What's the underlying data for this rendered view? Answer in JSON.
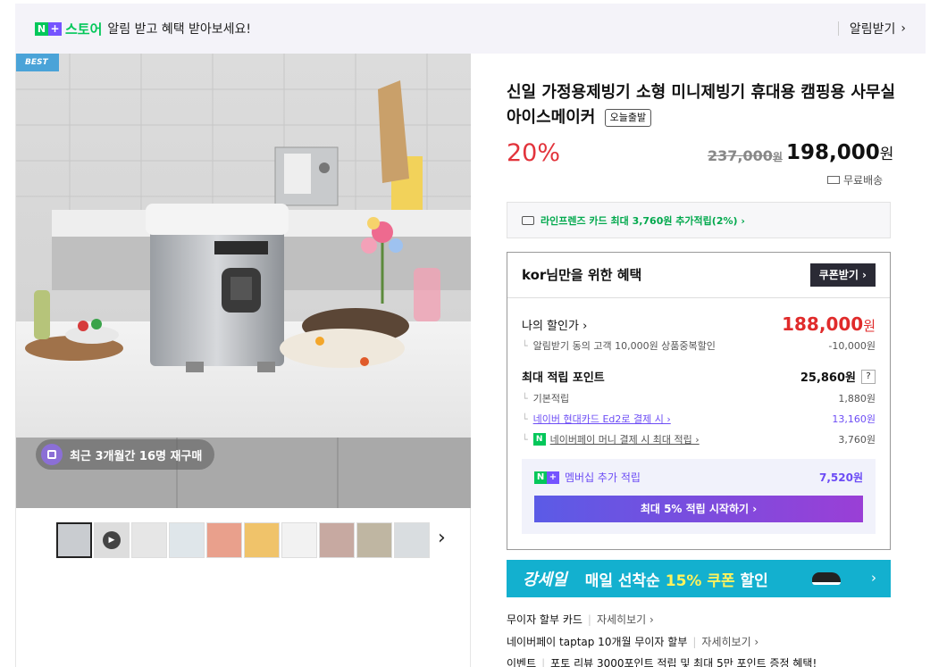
{
  "banner": {
    "store_name": "스토어",
    "message": "알림 받고 혜택 받아보세요!",
    "subscribe_label": "알림받기",
    "np_n": "N",
    "np_plus": "+"
  },
  "gallery": {
    "best_tag": "BEST",
    "repurchase_text": "최근 3개월간 16명 재구매",
    "thumb_count": 10
  },
  "product": {
    "title": "신일 가정용제빙기 소형 미니제빙기 휴대용 캠핑용 사무실 아이스메이커",
    "today_tag": "오늘출발",
    "discount": "20%",
    "original_price": "237,000",
    "original_unit": "원",
    "sale_price": "198,000",
    "sale_unit": "원",
    "shipping": "무료배송"
  },
  "card_offer": "라인프렌즈 카드 최대 3,760원 추가적립(2%) ›",
  "benefit": {
    "heading": "kor님만을 위한 혜택",
    "coupon_button": "쿠폰받기 ›",
    "my_price_label": "나의 할인가 ›",
    "my_price": "188,000",
    "my_price_unit": "원",
    "sub_discount_label": "알림받기 동의 고객 10,000원 상품중복할인",
    "sub_discount_value": "-10,000원",
    "points_label": "최대 적립 포인트",
    "points_value": "25,860원",
    "points_help": "?",
    "basic_label": "기본적립",
    "basic_value": "1,880원",
    "card_label": "네이버 현대카드 Ed2로 결제 시 ›",
    "card_value": "13,160원",
    "money_label": "네이버페이 머니 결제 시 최대 적립 ›",
    "money_value": "3,760원",
    "member_label": "멤버십 추가 적립",
    "member_value": "7,520원",
    "member_button": "최대 5% 적립 시작하기 ›"
  },
  "promo": {
    "brand": "강세일",
    "message_a": "매일 선착순 ",
    "message_b": "15% 쿠폰",
    "message_c": " 할인"
  },
  "info_lines": [
    {
      "label": "무이자 할부 카드",
      "more": "자세히보기 ›"
    },
    {
      "label": "네이버페이 taptap 10개월 무이자 할부",
      "more": "자세히보기 ›"
    },
    {
      "label": "이벤트",
      "more": "포토 리뷰 3000포인트 적립 및 최대 5만 포인트 증정 혜택!"
    }
  ],
  "colors": {
    "naver_green": "#03c75a",
    "sale_red": "#e2333b",
    "membership_purple": "#6c4cf5",
    "promo_cyan": "#13b0cf"
  }
}
